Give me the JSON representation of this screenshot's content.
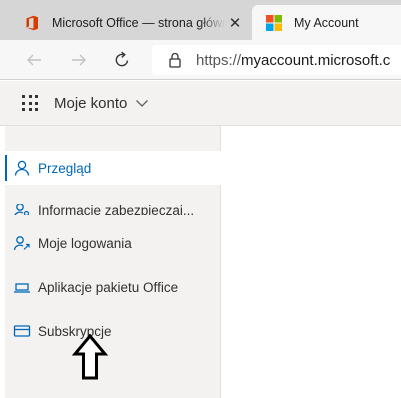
{
  "browser": {
    "tabs": [
      {
        "title": "Microsoft Office — strona główna",
        "close": "✕",
        "active": false
      },
      {
        "title": "My Account",
        "active": true
      }
    ],
    "address": {
      "scheme": "https://",
      "host": "myaccount.microsoft.c"
    }
  },
  "app": {
    "title": "Moje konto"
  },
  "sidebar": {
    "items": [
      {
        "label": "Przegląd",
        "active": true
      },
      {
        "label": "Informacje zabezpieczaj...",
        "active": false
      },
      {
        "label": "Moje logowania",
        "active": false
      },
      {
        "label": "Aplikacje pakietu Office",
        "active": false
      },
      {
        "label": "Subskrypcje",
        "active": false
      }
    ]
  },
  "colors": {
    "accent": "#0067b8",
    "office_icon": "#d83b01",
    "sidebar_bg": "#f3f2f1"
  }
}
